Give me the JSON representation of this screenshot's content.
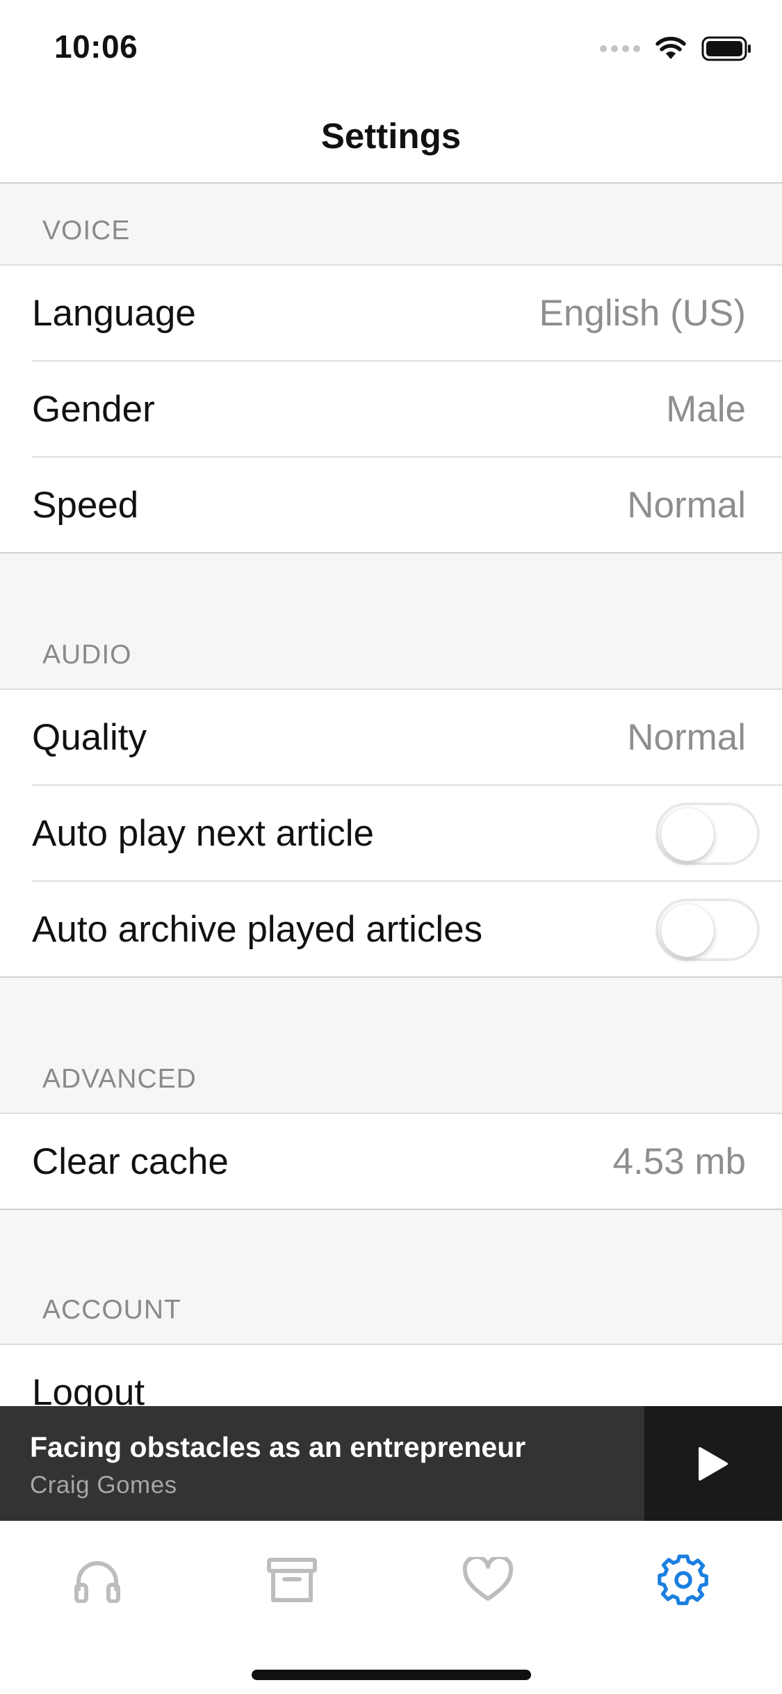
{
  "status_bar": {
    "time": "10:06"
  },
  "nav": {
    "title": "Settings"
  },
  "sections": {
    "voice": {
      "header": "VOICE",
      "rows": [
        {
          "label": "Language",
          "value": "English (US)"
        },
        {
          "label": "Gender",
          "value": "Male"
        },
        {
          "label": "Speed",
          "value": "Normal"
        }
      ]
    },
    "audio": {
      "header": "AUDIO",
      "rows": [
        {
          "label": "Quality",
          "value": "Normal"
        },
        {
          "label": "Auto play next article",
          "toggle": false
        },
        {
          "label": "Auto archive played articles",
          "toggle": false
        }
      ]
    },
    "advanced": {
      "header": "ADVANCED",
      "rows": [
        {
          "label": "Clear cache",
          "value": "4.53 mb"
        }
      ]
    },
    "account": {
      "header": "ACCOUNT",
      "rows": [
        {
          "label": "Logout"
        }
      ]
    }
  },
  "player": {
    "title": "Facing obstacles as an entrepreneur",
    "author": "Craig Gomes",
    "play_icon": "play-icon"
  },
  "tabs": [
    {
      "icon": "headphones-icon",
      "active": false
    },
    {
      "icon": "archive-icon",
      "active": false
    },
    {
      "icon": "heart-icon",
      "active": false
    },
    {
      "icon": "gear-icon",
      "active": true
    }
  ],
  "colors": {
    "accent": "#1a7fe0",
    "inactive_icon": "#bdbdbd",
    "player_bg": "#333333"
  }
}
